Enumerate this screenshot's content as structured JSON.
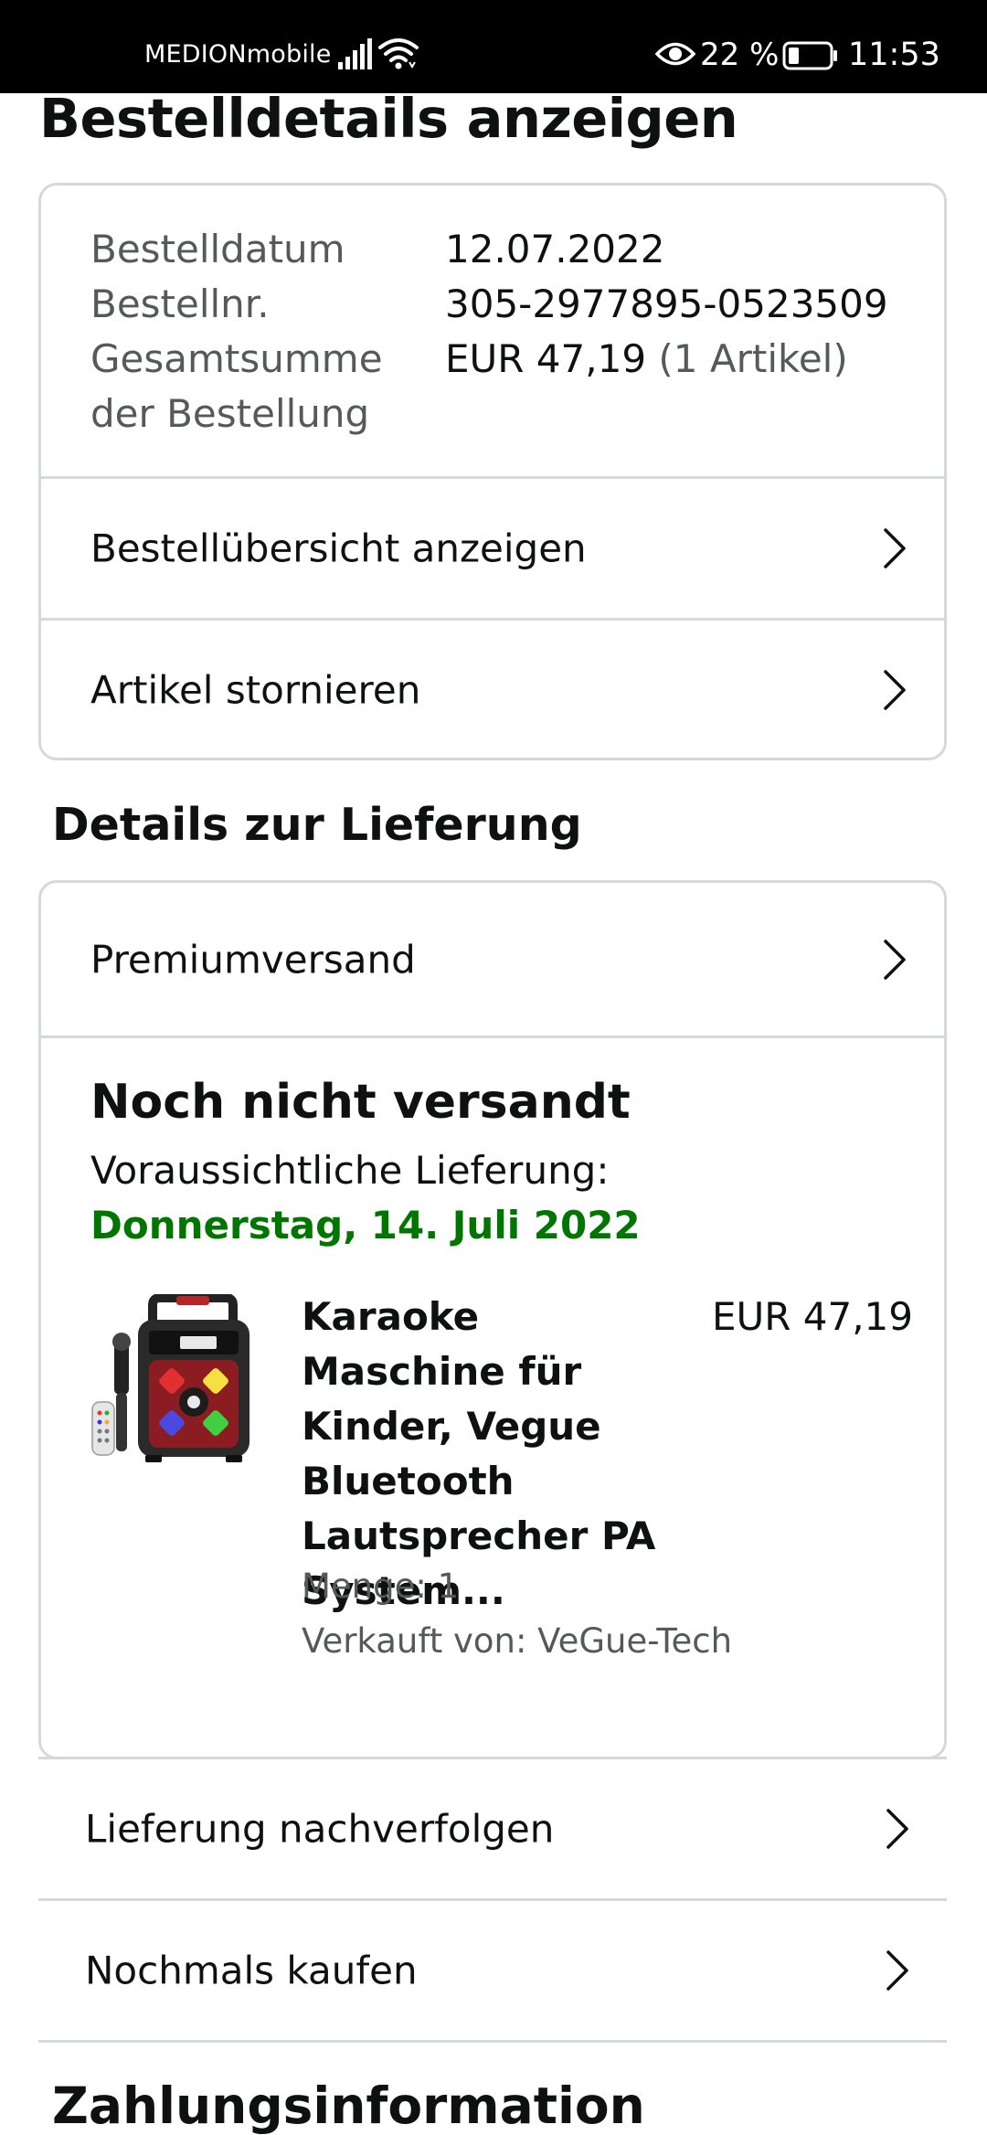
{
  "status_bar": {
    "carrier": "MEDIONmobile",
    "battery_percent": "22 %",
    "time": "11:53",
    "icons": [
      "signal-icon",
      "wifi-icon",
      "eye-icon",
      "battery-icon"
    ]
  },
  "page": {
    "title": "Bestelldetails anzeigen"
  },
  "order_summary": {
    "date_label": "Bestelldatum",
    "date_value": "12.07.2022",
    "number_label": "Bestellnr.",
    "number_value": "305-2977895-0523509",
    "total_label": "Gesamtsumme der Bestellung",
    "total_value": "EUR 47,19",
    "total_count": "(1 Artikel)"
  },
  "order_actions": [
    {
      "label": "Bestellübersicht anzeigen"
    },
    {
      "label": "Artikel stornieren"
    }
  ],
  "delivery": {
    "section_title": "Details zur Lieferung",
    "shipping_method": "Premiumversand",
    "status": "Noch nicht versandt",
    "expected_label": "Voraussichtliche Lieferung:",
    "expected_date": "Donnerstag, 14. Juli 2022",
    "item": {
      "title": "Karaoke Maschine für Kinder, Vegue Bluetooth Lautsprecher PA System...",
      "price": "EUR 47,19",
      "quantity": "Menge: 1",
      "seller": "Verkauft von: VeGue-Tech"
    }
  },
  "shipment_actions": [
    {
      "label": "Lieferung nachverfolgen"
    },
    {
      "label": "Nochmals kaufen"
    }
  ],
  "payment": {
    "section_title": "Zahlungsinformation"
  },
  "colors": {
    "status_bar": "#000000",
    "text": "#0f1111",
    "muted_text": "#565959",
    "border": "#d5d9d9",
    "delivery_green": "#007600"
  }
}
